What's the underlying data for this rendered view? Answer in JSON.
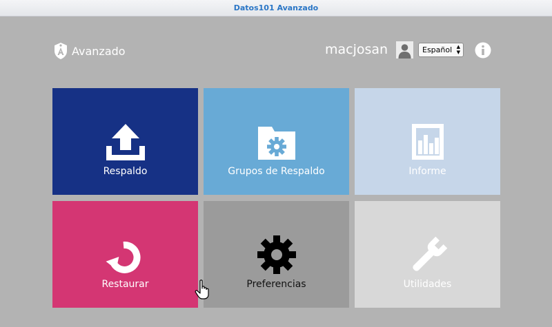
{
  "window": {
    "title": "Datos101 Avanzado"
  },
  "header": {
    "logo_text": "Avanzado",
    "username": "macjosan",
    "language": {
      "selected": "Español"
    }
  },
  "tiles": [
    {
      "label": "Respaldo",
      "icon": "upload-icon",
      "color": "#163185"
    },
    {
      "label": "Grupos de Respaldo",
      "icon": "folder-gear-icon",
      "color": "#68aad6"
    },
    {
      "label": "Informe",
      "icon": "report-chart-icon",
      "color": "#c6d6e9"
    },
    {
      "label": "Restaurar",
      "icon": "restore-icon",
      "color": "#d43673"
    },
    {
      "label": "Preferencias",
      "icon": "gear-icon",
      "color": "#9b9b9b"
    },
    {
      "label": "Utilidades",
      "icon": "wrench-icon",
      "color": "#d8d8d8"
    }
  ]
}
